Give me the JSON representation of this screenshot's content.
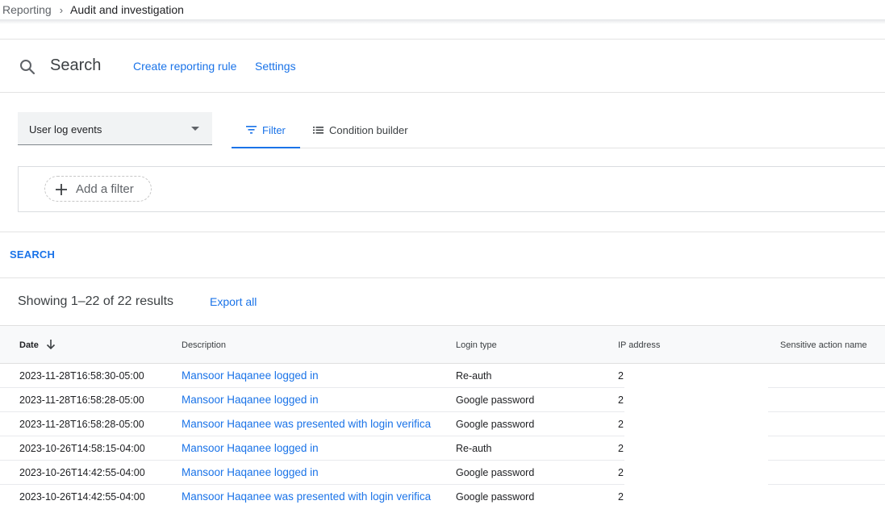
{
  "breadcrumb": {
    "root": "Reporting",
    "separator": "›",
    "current": "Audit and investigation"
  },
  "search_header": {
    "title": "Search",
    "create_rule_label": "Create reporting rule",
    "settings_label": "Settings"
  },
  "data_source": {
    "selected": "User log events"
  },
  "tabs": [
    {
      "label": "Filter",
      "icon": "filter-icon",
      "active": true
    },
    {
      "label": "Condition builder",
      "icon": "list-icon",
      "active": false
    }
  ],
  "add_filter_label": "Add a filter",
  "search_button_label": "SEARCH",
  "results": {
    "count_text": "Showing 1–22 of 22 results",
    "export_label": "Export all"
  },
  "table": {
    "columns": [
      "Date",
      "Description",
      "Login type",
      "IP address",
      "Sensitive action name"
    ],
    "sort": {
      "column": "Date",
      "direction": "descending"
    },
    "rows": [
      {
        "date": "2023-11-28T16:58:30-05:00",
        "description": "Mansoor Haqanee logged in",
        "login_type": "Re-auth",
        "ip": "2"
      },
      {
        "date": "2023-11-28T16:58:28-05:00",
        "description": "Mansoor Haqanee logged in",
        "login_type": "Google password",
        "ip": "2"
      },
      {
        "date": "2023-11-28T16:58:28-05:00",
        "description": "Mansoor Haqanee was presented with login verifica",
        "login_type": "Google password",
        "ip": "2"
      },
      {
        "date": "2023-10-26T14:58:15-04:00",
        "description": "Mansoor Haqanee logged in",
        "login_type": "Re-auth",
        "ip": "2"
      },
      {
        "date": "2023-10-26T14:42:55-04:00",
        "description": "Mansoor Haqanee logged in",
        "login_type": "Google password",
        "ip": "2"
      },
      {
        "date": "2023-10-26T14:42:55-04:00",
        "description": "Mansoor Haqanee was presented with login verifica",
        "login_type": "Google password",
        "ip": "2"
      }
    ]
  },
  "colors": {
    "accent": "#1a73e8",
    "text": "#202124",
    "muted": "#5f6368",
    "header_bg": "#f8f9fa"
  }
}
